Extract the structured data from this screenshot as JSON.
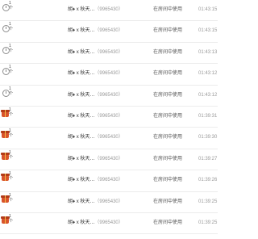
{
  "records": [
    {
      "icon": "clock-icon",
      "count": "1个",
      "user": "胡♦ x 秋天…",
      "uid": "（9965430）",
      "status": "在房间中使用",
      "time": "01:43:15"
    },
    {
      "icon": "clock-icon",
      "count": "1个",
      "user": "胡♦ x 秋天…",
      "uid": "（9965430）",
      "status": "在房间中使用",
      "time": "01:43:15"
    },
    {
      "icon": "clock-icon",
      "count": "1个",
      "user": "胡♦ x 秋天…",
      "uid": "（9965430）",
      "status": "在房间中使用",
      "time": "01:43:13"
    },
    {
      "icon": "clock-icon",
      "count": "1个",
      "user": "胡♦ x 秋天…",
      "uid": "（9965430）",
      "status": "在房间中使用",
      "time": "01:43:12"
    },
    {
      "icon": "clock-icon",
      "count": "1个",
      "user": "胡♦ x 秋天…",
      "uid": "（9965430）",
      "status": "在房间中使用",
      "time": "01:43:12"
    },
    {
      "icon": "gift-icon",
      "count": "1个",
      "user": "胡♦ x 秋天…",
      "uid": "（9965430）",
      "status": "在房间中使用",
      "time": "01:39:31"
    },
    {
      "icon": "gift-icon",
      "count": "1个",
      "user": "胡♦ x 秋天…",
      "uid": "（9965430）",
      "status": "在房间中使用",
      "time": "01:39:30"
    },
    {
      "icon": "gift-icon",
      "count": "1个",
      "user": "胡♦ x 秋天…",
      "uid": "（9965430）",
      "status": "在房间中使用",
      "time": "01:39:27"
    },
    {
      "icon": "gift-icon",
      "count": "1个",
      "user": "胡♦ x 秋天…",
      "uid": "（9965430）",
      "status": "在房间中使用",
      "time": "01:39:26"
    },
    {
      "icon": "gift-icon",
      "count": "1个",
      "user": "胡♦ x 秋天…",
      "uid": "（9965430）",
      "status": "在房间中使用",
      "time": "01:39:25"
    },
    {
      "icon": "gift-icon",
      "count": "1个",
      "user": "胡♦ x 秋天…",
      "uid": "（9965430）",
      "status": "在房间中使用",
      "time": "01:39:25"
    }
  ]
}
